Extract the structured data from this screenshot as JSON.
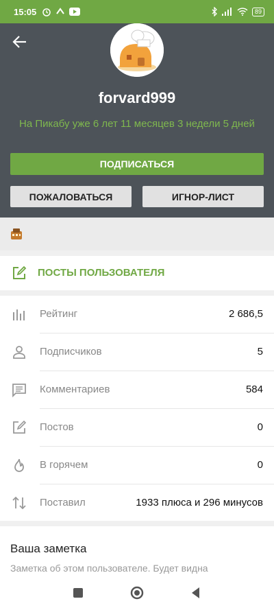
{
  "status": {
    "time": "15:05",
    "battery": "89"
  },
  "profile": {
    "username": "forvard999",
    "since": "На Пикабу уже 6 лет 11 месяцев 3 недели 5 дней",
    "subscribe_label": "ПОДПИСАТЬСЯ",
    "report_label": "ПОЖАЛОВАТЬСЯ",
    "ignore_label": "ИГНОР-ЛИСТ"
  },
  "posts_link": {
    "label": "ПОСТЫ ПОЛЬЗОВАТЕЛЯ",
    "icon": "edit-icon"
  },
  "stats": [
    {
      "icon": "bar-chart-icon",
      "label": "Рейтинг",
      "value": "2 686,5"
    },
    {
      "icon": "person-icon",
      "label": "Подписчиков",
      "value": "5"
    },
    {
      "icon": "comment-icon",
      "label": "Комментариев",
      "value": "584"
    },
    {
      "icon": "edit-icon",
      "label": "Постов",
      "value": "0"
    },
    {
      "icon": "fire-icon",
      "label": "В горячем",
      "value": "0"
    },
    {
      "icon": "up-down-arrows-icon",
      "label": "Поставил",
      "value": "1933 плюса и 296 минусов"
    }
  ],
  "note": {
    "title": "Ваша заметка",
    "text": "Заметка об этом пользователе. Будет видна"
  },
  "colors": {
    "accent": "#70a844",
    "header_bg": "#4d5359",
    "text_muted": "#888888"
  }
}
